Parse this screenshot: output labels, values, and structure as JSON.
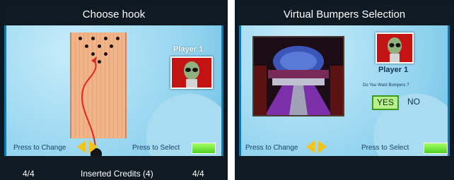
{
  "left": {
    "title": "Choose hook",
    "player": "Player 1",
    "press_change": "Press to Change",
    "press_select": "Press to Select",
    "footer": {
      "left_count": "4/4",
      "credits": "Inserted Credits (4)",
      "right_count": "4/4"
    }
  },
  "right": {
    "title": "Virtual Bumpers Selection",
    "player": "Player 1",
    "question": "Do You Want Bumpers ?",
    "yes": "YES",
    "no": "NO",
    "press_change": "Press to Change",
    "press_select": "Press to Select"
  },
  "colors": {
    "accent_yellow": "#f4c41d",
    "select_green": "#4fd120",
    "avatar_red": "#c41313",
    "frame_blue": "#1577b0"
  },
  "icons": [
    "arrow-left-icon",
    "arrow-right-icon",
    "alien-avatar-icon",
    "bowling-ball-icon",
    "bowling-pin-icon"
  ]
}
